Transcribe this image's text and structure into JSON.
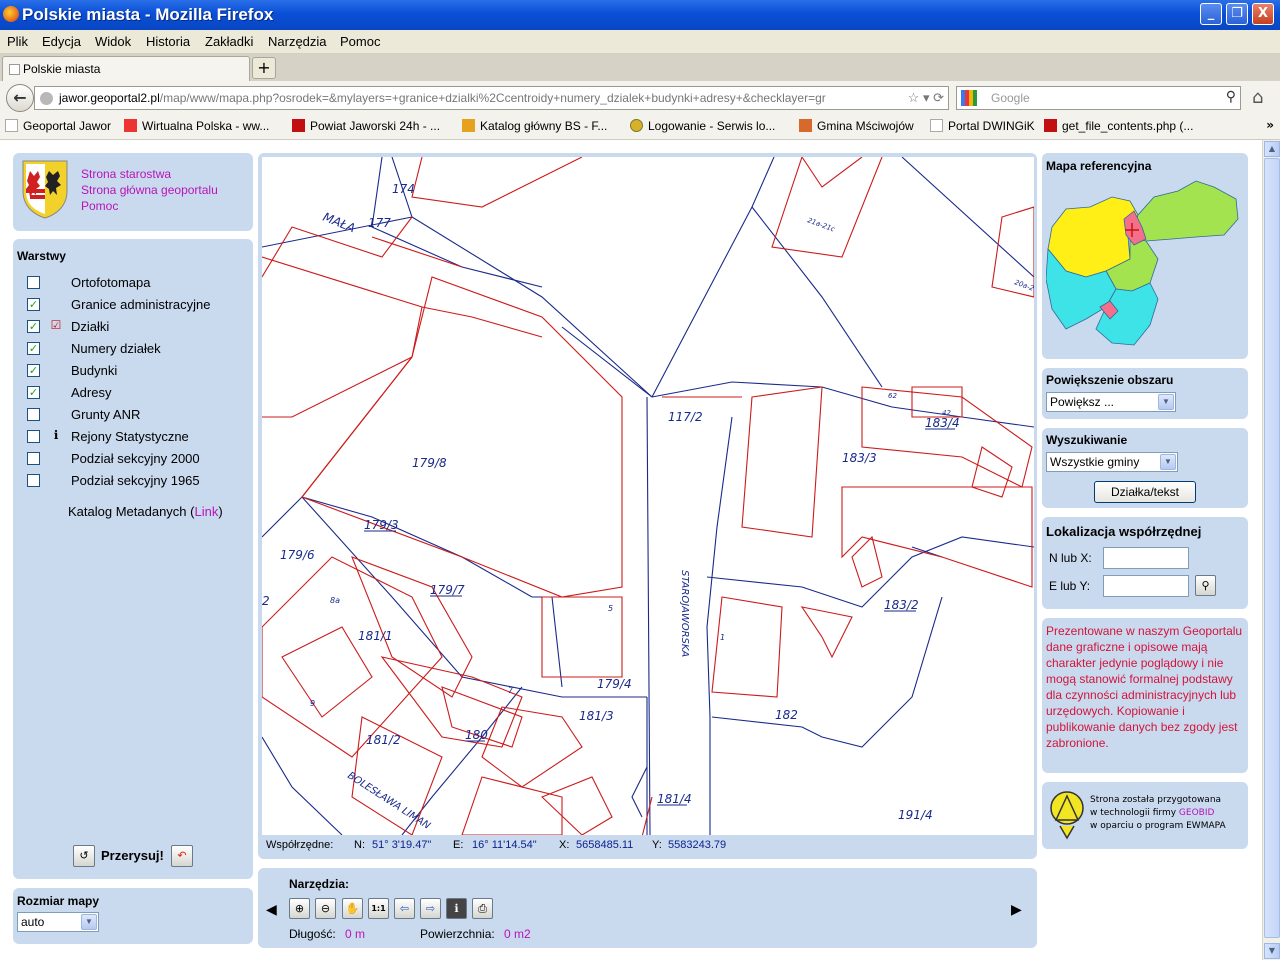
{
  "window": {
    "title": "Polskie miasta - Mozilla Firefox",
    "min": "_",
    "max": "❐",
    "close": "X"
  },
  "menu": [
    "Plik",
    "Edycja",
    "Widok",
    "Historia",
    "Zakładki",
    "Narzędzia",
    "Pomoc"
  ],
  "tab": {
    "label": "Polskie miasta",
    "new_tab": "+"
  },
  "nav": {
    "url_host": "jawor.geoportal2.pl",
    "url_path": "/map/www/mapa.php?osrodek=&mylayers=+granice+dzialki%2Ccentroidy+numery_dzialek+budynki+adresy+&checklayer=gr",
    "search_placeholder": "Google"
  },
  "bookmarks": [
    "Geoportal Jawor",
    "Wirtualna Polska - ww...",
    "Powiat Jaworski 24h - ...",
    "Katalog główny BS - F...",
    "Logowanie - Serwis lo...",
    "Gmina Mściwojów",
    "Portal DWINGiK",
    "get_file_contents.php (..."
  ],
  "bookmarks_more": "»",
  "links": [
    "Strona starostwa",
    "Strona główna geoportalu",
    "Pomoc"
  ],
  "layers": {
    "title": "Warstwy",
    "items": [
      {
        "label": "Ortofotomapa",
        "checked": false,
        "icon": ""
      },
      {
        "label": "Granice administracyjne",
        "checked": true,
        "icon": ""
      },
      {
        "label": "Działki",
        "checked": true,
        "icon": "check-legend-icon"
      },
      {
        "label": "Numery działek",
        "checked": true,
        "icon": ""
      },
      {
        "label": "Budynki",
        "checked": true,
        "icon": ""
      },
      {
        "label": "Adresy",
        "checked": true,
        "icon": ""
      },
      {
        "label": "Grunty ANR",
        "checked": false,
        "icon": ""
      },
      {
        "label": "Rejony Statystyczne",
        "checked": false,
        "icon": "info-legend-icon"
      },
      {
        "label": "Podział sekcyjny 2000",
        "checked": false,
        "icon": ""
      },
      {
        "label": "Podział sekcyjny 1965",
        "checked": false,
        "icon": ""
      }
    ],
    "catalog_prefix": "Katalog Metadanych (",
    "catalog_link": "Link",
    "catalog_suffix": ")"
  },
  "redraw_label": "Przerysuj!",
  "map_size": {
    "title": "Rozmiar mapy",
    "value": "auto"
  },
  "ref_map": {
    "title": "Mapa referencyjna"
  },
  "zoom_area": {
    "title": "Powiększenie obszaru",
    "value": "Powiększ ..."
  },
  "search": {
    "title": "Wyszukiwanie",
    "value": "Wszystkie gminy",
    "button": "Działka/tekst"
  },
  "coord_locate": {
    "title": "Lokalizacja współrzędnej",
    "n_label": "N lub X:",
    "e_label": "E lub Y:"
  },
  "notice": "Prezentowane w naszym Geoportalu dane graficzne i opisowe mają charakter jedynie poglądowy i nie mogą stanowić formalnej podstawy dla czynności administracyjnych lub urzędowych. Kopiowanie i publikowanie danych bez zgody jest zabronione.",
  "footer": {
    "line1": "Strona została przygotowana",
    "line2_prefix": "w technologii firmy ",
    "line2_brand": "GEOBID",
    "line3": "w oparciu o program EWMAPA"
  },
  "coords": {
    "label": "Współrzędne:",
    "n_label": "N:",
    "n": "51° 3'19.47\"",
    "e_label": "E:",
    "e": "16° 11'14.54\"",
    "x_label": "X:",
    "x": "5658485.11",
    "y_label": "Y:",
    "y": "5583243.79"
  },
  "tools": {
    "title": "Narzędzia:",
    "length_label": "Długość:",
    "length": "0 m",
    "area_label": "Powierzchnia:",
    "area": "0 m2",
    "buttons": [
      "zoom-in-icon",
      "zoom-out-icon",
      "pan-hand-icon",
      "scale-1-1-icon",
      "previous-view-icon",
      "next-view-icon",
      "info-icon",
      "print-icon"
    ]
  },
  "map_labels": [
    "MAŁA",
    "177",
    "174",
    "21a-21c",
    "20a-20c",
    "117/2",
    "179/8",
    "183/3",
    "183/4",
    "179/3",
    "179/6",
    "179/7",
    "181/1",
    "179/4",
    "181/3",
    "183/2",
    "180",
    "181/2",
    "182",
    "181/4",
    "191/4",
    "STAROJAWORSKA",
    "BOLESŁAWA LIMAN",
    "2",
    "42",
    "62",
    "1",
    "5",
    "9",
    "8a",
    "7"
  ],
  "colors": {
    "panel": "#c9d9ee",
    "parcel": "#cc1b1b",
    "boundary": "#1a2a8a",
    "link": "#b815b8",
    "notice": "#d4143a"
  }
}
